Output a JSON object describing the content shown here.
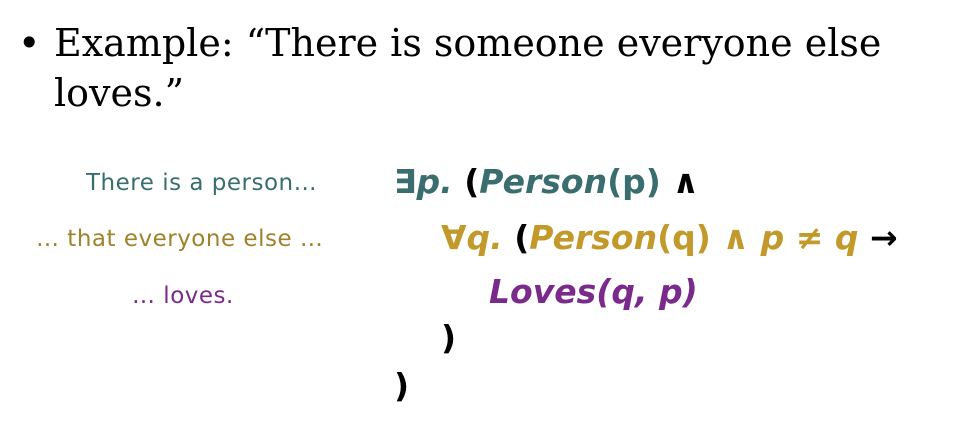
{
  "bullet": {
    "dot": "•",
    "text": "Example: “There is someone everyone else loves.”"
  },
  "annotations": {
    "line1": "There is a person…",
    "line2": "… that everyone else …",
    "line3": "… loves."
  },
  "formula": {
    "line1": {
      "quantifier": "∃p.",
      "open_paren": "(",
      "predicate": "Person",
      "args": "(p)",
      "connective": "∧"
    },
    "line2": {
      "quantifier": "∀q.",
      "open_paren": "(",
      "predicate": "Person",
      "args": "(q)",
      "and": "∧",
      "neq": "p ≠ q",
      "implies": "→"
    },
    "line3": {
      "predicate": "Loves",
      "args": "(q, p)"
    },
    "line4": {
      "close_paren": ")"
    },
    "line5": {
      "close_paren": ")"
    }
  },
  "colors": {
    "teal": "#3a6e6e",
    "gold": "#c2992a",
    "purple": "#7a2a8a",
    "text": "#000000",
    "background": "#ffffff"
  }
}
